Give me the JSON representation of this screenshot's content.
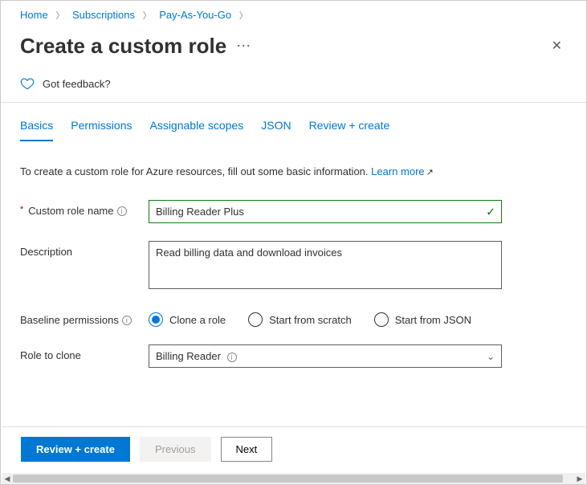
{
  "breadcrumb": {
    "items": [
      "Home",
      "Subscriptions",
      "Pay-As-You-Go"
    ]
  },
  "header": {
    "title": "Create a custom role"
  },
  "feedback": {
    "label": "Got feedback?"
  },
  "tabs": {
    "items": [
      {
        "label": "Basics",
        "active": true
      },
      {
        "label": "Permissions",
        "active": false
      },
      {
        "label": "Assignable scopes",
        "active": false
      },
      {
        "label": "JSON",
        "active": false
      },
      {
        "label": "Review + create",
        "active": false
      }
    ]
  },
  "intro": {
    "text": "To create a custom role for Azure resources, fill out some basic information.",
    "learn_more": "Learn more"
  },
  "form": {
    "name_label": "Custom role name",
    "name_value": "Billing Reader Plus",
    "desc_label": "Description",
    "desc_value": "Read billing data and download invoices",
    "baseline_label": "Baseline permissions",
    "baseline_options": [
      {
        "label": "Clone a role"
      },
      {
        "label": "Start from scratch"
      },
      {
        "label": "Start from JSON"
      }
    ],
    "clone_label": "Role to clone",
    "clone_value": "Billing Reader"
  },
  "footer": {
    "review": "Review + create",
    "previous": "Previous",
    "next": "Next"
  }
}
